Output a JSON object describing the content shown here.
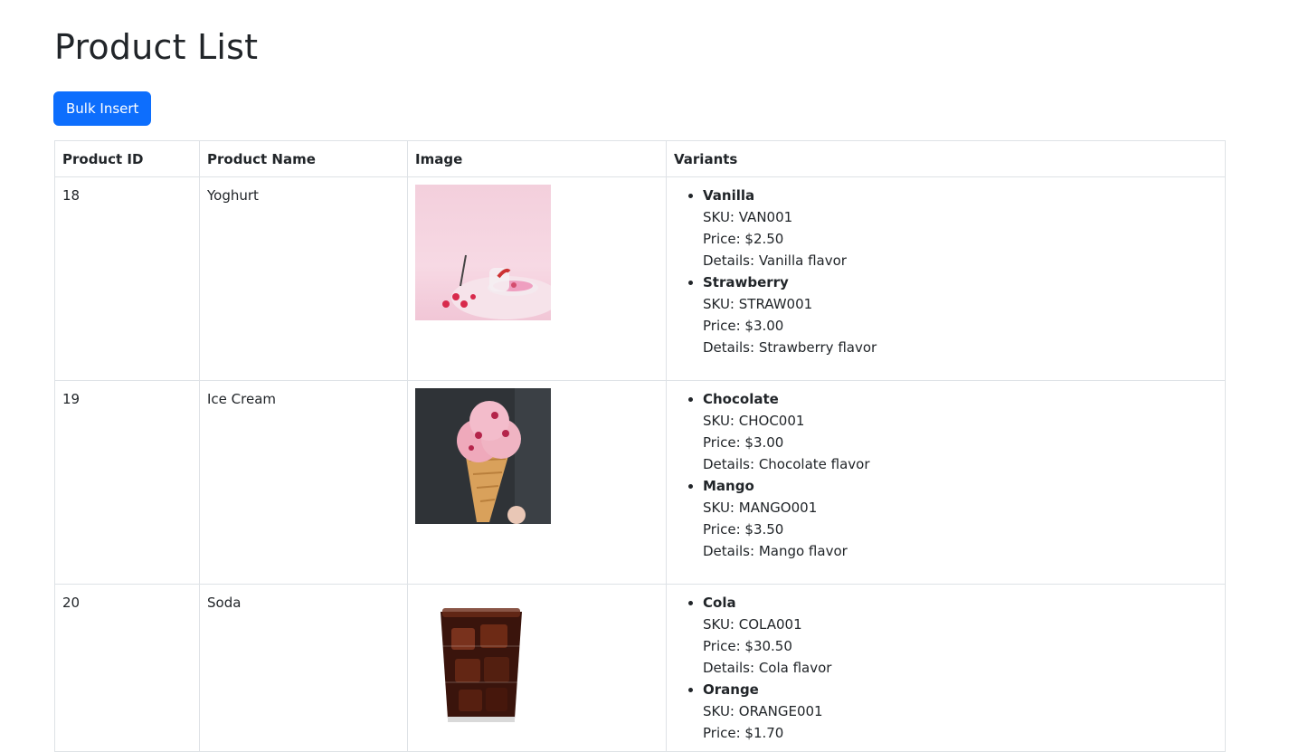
{
  "page": {
    "title": "Product List"
  },
  "toolbar": {
    "bulk_insert_label": "Bulk Insert",
    "accent": "#0d6efd"
  },
  "table": {
    "headers": [
      "Product ID",
      "Product Name",
      "Image",
      "Variants"
    ],
    "rows": [
      {
        "id": "18",
        "name": "Yoghurt",
        "image": "yoghurt-photo",
        "variants": [
          {
            "name": "Vanilla",
            "sku": "SKU: VAN001",
            "price": "Price: $2.50",
            "details": "Details: Vanilla flavor"
          },
          {
            "name": "Strawberry",
            "sku": "SKU: STRAW001",
            "price": "Price: $3.00",
            "details": "Details: Strawberry flavor"
          }
        ]
      },
      {
        "id": "19",
        "name": "Ice Cream",
        "image": "ice-cream-photo",
        "variants": [
          {
            "name": "Chocolate",
            "sku": "SKU: CHOC001",
            "price": "Price: $3.00",
            "details": "Details: Chocolate flavor"
          },
          {
            "name": "Mango",
            "sku": "SKU: MANGO001",
            "price": "Price: $3.50",
            "details": "Details: Mango flavor"
          }
        ]
      },
      {
        "id": "20",
        "name": "Soda",
        "image": "soda-photo",
        "variants": [
          {
            "name": "Cola",
            "sku": "SKU: COLA001",
            "price": "Price: $30.50",
            "details": "Details: Cola flavor"
          },
          {
            "name": "Orange",
            "sku": "SKU: ORANGE001",
            "price": "Price: $1.70",
            "details": ""
          }
        ]
      }
    ]
  }
}
